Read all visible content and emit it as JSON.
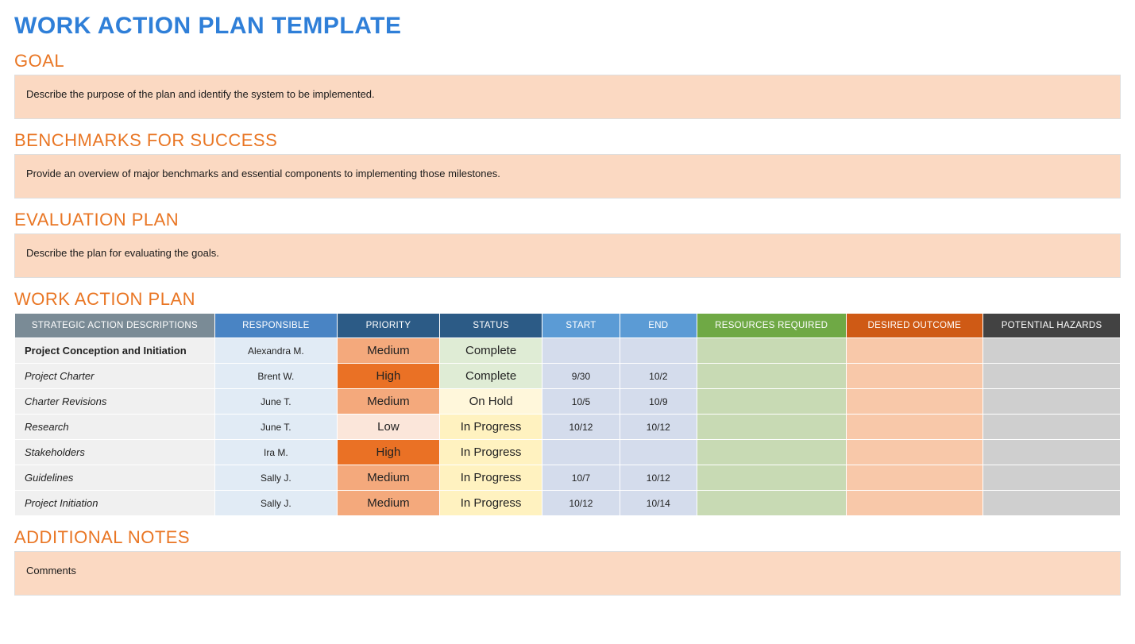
{
  "title": "WORK ACTION PLAN TEMPLATE",
  "sections": {
    "goal": {
      "heading": "GOAL",
      "text": "Describe the purpose of the plan and identify the system to be implemented."
    },
    "benchmarks": {
      "heading": "BENCHMARKS FOR SUCCESS",
      "text": "Provide an overview of major benchmarks and essential components to implementing those milestones."
    },
    "evaluation": {
      "heading": "EVALUATION PLAN",
      "text": "Describe the plan for evaluating the goals."
    },
    "workplan": {
      "heading": "WORK ACTION PLAN"
    },
    "notes": {
      "heading": "ADDITIONAL NOTES",
      "text": "Comments"
    }
  },
  "table": {
    "headers": {
      "desc": "STRATEGIC ACTION DESCRIPTIONS",
      "resp": "RESPONSIBLE",
      "prio": "PRIORITY",
      "stat": "STATUS",
      "start": "START",
      "end": "END",
      "res": "RESOURCES REQUIRED",
      "out": "DESIRED OUTCOME",
      "haz": "POTENTIAL HAZARDS"
    },
    "rows": [
      {
        "desc": "Project Conception and Initiation",
        "bold": true,
        "resp": "Alexandra M.",
        "prio": "Medium",
        "prio_cls": "prio-medium",
        "stat": "Complete",
        "stat_cls": "stat-complete",
        "start": "",
        "end": "",
        "res": "",
        "out": "",
        "haz": ""
      },
      {
        "desc": "Project Charter",
        "bold": false,
        "resp": "Brent W.",
        "prio": "High",
        "prio_cls": "prio-high",
        "stat": "Complete",
        "stat_cls": "stat-complete",
        "start": "9/30",
        "end": "10/2",
        "res": "",
        "out": "",
        "haz": ""
      },
      {
        "desc": "Charter Revisions",
        "bold": false,
        "resp": "June T.",
        "prio": "Medium",
        "prio_cls": "prio-medium",
        "stat": "On Hold",
        "stat_cls": "stat-hold",
        "start": "10/5",
        "end": "10/9",
        "res": "",
        "out": "",
        "haz": ""
      },
      {
        "desc": "Research",
        "bold": false,
        "resp": "June T.",
        "prio": "Low",
        "prio_cls": "prio-low",
        "stat": "In Progress",
        "stat_cls": "stat-progress",
        "start": "10/12",
        "end": "10/12",
        "res": "",
        "out": "",
        "haz": ""
      },
      {
        "desc": "Stakeholders",
        "bold": false,
        "resp": "Ira M.",
        "prio": "High",
        "prio_cls": "prio-high",
        "stat": "In Progress",
        "stat_cls": "stat-progress",
        "start": "",
        "end": "",
        "res": "",
        "out": "",
        "haz": ""
      },
      {
        "desc": "Guidelines",
        "bold": false,
        "resp": "Sally J.",
        "prio": "Medium",
        "prio_cls": "prio-medium",
        "stat": "In Progress",
        "stat_cls": "stat-progress",
        "start": "10/7",
        "end": "10/12",
        "res": "",
        "out": "",
        "haz": ""
      },
      {
        "desc": "Project Initiation",
        "bold": false,
        "resp": "Sally J.",
        "prio": "Medium",
        "prio_cls": "prio-medium",
        "stat": "In Progress",
        "stat_cls": "stat-progress",
        "start": "10/12",
        "end": "10/14",
        "res": "",
        "out": "",
        "haz": ""
      }
    ]
  }
}
